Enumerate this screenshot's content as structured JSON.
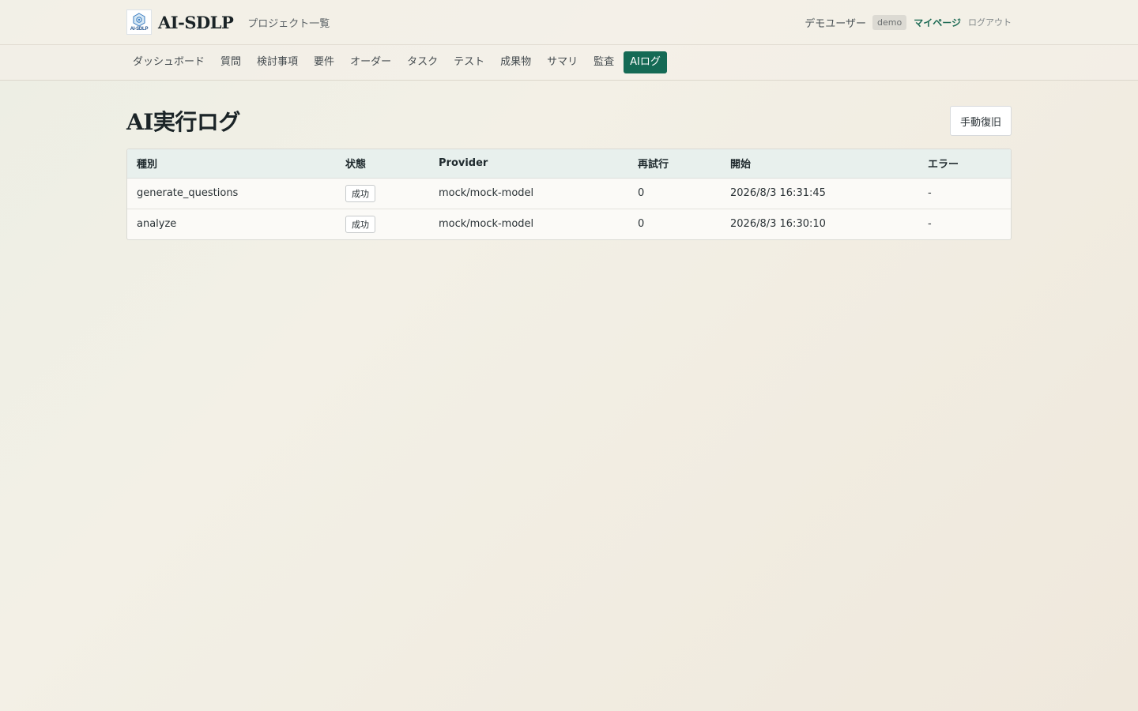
{
  "header": {
    "logo_text": "AI-SDLP",
    "app_title": "AI-SDLP",
    "project_list_link": "プロジェクト一覧",
    "user_name": "デモユーザー",
    "user_badge": "demo",
    "mypage_link": "マイページ",
    "logout_link": "ログアウト"
  },
  "nav": {
    "items": [
      {
        "label": "ダッシュボード",
        "active": false
      },
      {
        "label": "質問",
        "active": false
      },
      {
        "label": "検討事項",
        "active": false
      },
      {
        "label": "要件",
        "active": false
      },
      {
        "label": "オーダー",
        "active": false
      },
      {
        "label": "タスク",
        "active": false
      },
      {
        "label": "テスト",
        "active": false
      },
      {
        "label": "成果物",
        "active": false
      },
      {
        "label": "サマリ",
        "active": false
      },
      {
        "label": "監査",
        "active": false
      },
      {
        "label": "AIログ",
        "active": true
      }
    ]
  },
  "main": {
    "page_title": "AI実行ログ",
    "recover_button": "手動復旧",
    "table": {
      "columns": [
        "種別",
        "状態",
        "Provider",
        "再試行",
        "開始",
        "エラー"
      ],
      "rows": [
        {
          "type": "generate_questions",
          "status": "成功",
          "provider": "mock/mock-model",
          "retry": "0",
          "started": "2026/8/3 16:31:45",
          "error": "-"
        },
        {
          "type": "analyze",
          "status": "成功",
          "provider": "mock/mock-model",
          "retry": "0",
          "started": "2026/8/3 16:30:10",
          "error": "-"
        }
      ]
    }
  },
  "colors": {
    "accent": "#156a55",
    "table_header_bg": "#e8f0ed"
  }
}
